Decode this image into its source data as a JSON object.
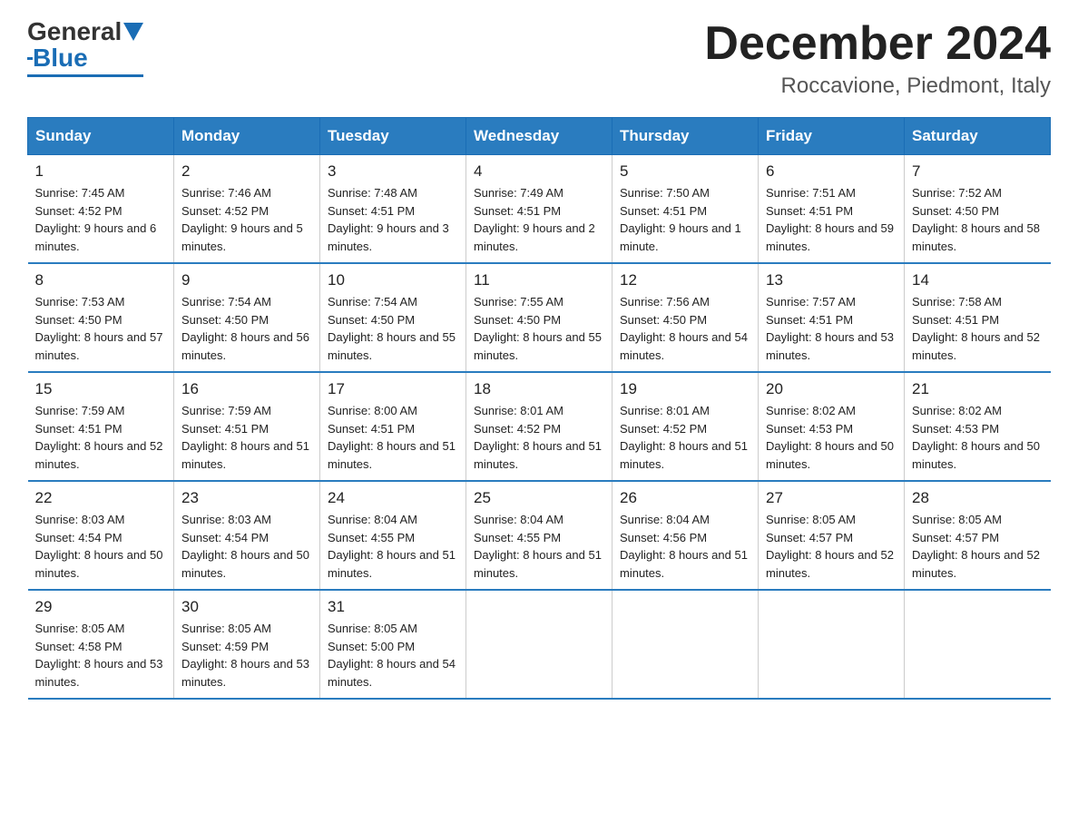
{
  "logo": {
    "text_general": "General",
    "text_blue": "Blue"
  },
  "header": {
    "month": "December 2024",
    "location": "Roccavione, Piedmont, Italy"
  },
  "days_of_week": [
    "Sunday",
    "Monday",
    "Tuesday",
    "Wednesday",
    "Thursday",
    "Friday",
    "Saturday"
  ],
  "weeks": [
    [
      {
        "day": "1",
        "sunrise": "7:45 AM",
        "sunset": "4:52 PM",
        "daylight": "9 hours and 6 minutes."
      },
      {
        "day": "2",
        "sunrise": "7:46 AM",
        "sunset": "4:52 PM",
        "daylight": "9 hours and 5 minutes."
      },
      {
        "day": "3",
        "sunrise": "7:48 AM",
        "sunset": "4:51 PM",
        "daylight": "9 hours and 3 minutes."
      },
      {
        "day": "4",
        "sunrise": "7:49 AM",
        "sunset": "4:51 PM",
        "daylight": "9 hours and 2 minutes."
      },
      {
        "day": "5",
        "sunrise": "7:50 AM",
        "sunset": "4:51 PM",
        "daylight": "9 hours and 1 minute."
      },
      {
        "day": "6",
        "sunrise": "7:51 AM",
        "sunset": "4:51 PM",
        "daylight": "8 hours and 59 minutes."
      },
      {
        "day": "7",
        "sunrise": "7:52 AM",
        "sunset": "4:50 PM",
        "daylight": "8 hours and 58 minutes."
      }
    ],
    [
      {
        "day": "8",
        "sunrise": "7:53 AM",
        "sunset": "4:50 PM",
        "daylight": "8 hours and 57 minutes."
      },
      {
        "day": "9",
        "sunrise": "7:54 AM",
        "sunset": "4:50 PM",
        "daylight": "8 hours and 56 minutes."
      },
      {
        "day": "10",
        "sunrise": "7:54 AM",
        "sunset": "4:50 PM",
        "daylight": "8 hours and 55 minutes."
      },
      {
        "day": "11",
        "sunrise": "7:55 AM",
        "sunset": "4:50 PM",
        "daylight": "8 hours and 55 minutes."
      },
      {
        "day": "12",
        "sunrise": "7:56 AM",
        "sunset": "4:50 PM",
        "daylight": "8 hours and 54 minutes."
      },
      {
        "day": "13",
        "sunrise": "7:57 AM",
        "sunset": "4:51 PM",
        "daylight": "8 hours and 53 minutes."
      },
      {
        "day": "14",
        "sunrise": "7:58 AM",
        "sunset": "4:51 PM",
        "daylight": "8 hours and 52 minutes."
      }
    ],
    [
      {
        "day": "15",
        "sunrise": "7:59 AM",
        "sunset": "4:51 PM",
        "daylight": "8 hours and 52 minutes."
      },
      {
        "day": "16",
        "sunrise": "7:59 AM",
        "sunset": "4:51 PM",
        "daylight": "8 hours and 51 minutes."
      },
      {
        "day": "17",
        "sunrise": "8:00 AM",
        "sunset": "4:51 PM",
        "daylight": "8 hours and 51 minutes."
      },
      {
        "day": "18",
        "sunrise": "8:01 AM",
        "sunset": "4:52 PM",
        "daylight": "8 hours and 51 minutes."
      },
      {
        "day": "19",
        "sunrise": "8:01 AM",
        "sunset": "4:52 PM",
        "daylight": "8 hours and 51 minutes."
      },
      {
        "day": "20",
        "sunrise": "8:02 AM",
        "sunset": "4:53 PM",
        "daylight": "8 hours and 50 minutes."
      },
      {
        "day": "21",
        "sunrise": "8:02 AM",
        "sunset": "4:53 PM",
        "daylight": "8 hours and 50 minutes."
      }
    ],
    [
      {
        "day": "22",
        "sunrise": "8:03 AM",
        "sunset": "4:54 PM",
        "daylight": "8 hours and 50 minutes."
      },
      {
        "day": "23",
        "sunrise": "8:03 AM",
        "sunset": "4:54 PM",
        "daylight": "8 hours and 50 minutes."
      },
      {
        "day": "24",
        "sunrise": "8:04 AM",
        "sunset": "4:55 PM",
        "daylight": "8 hours and 51 minutes."
      },
      {
        "day": "25",
        "sunrise": "8:04 AM",
        "sunset": "4:55 PM",
        "daylight": "8 hours and 51 minutes."
      },
      {
        "day": "26",
        "sunrise": "8:04 AM",
        "sunset": "4:56 PM",
        "daylight": "8 hours and 51 minutes."
      },
      {
        "day": "27",
        "sunrise": "8:05 AM",
        "sunset": "4:57 PM",
        "daylight": "8 hours and 52 minutes."
      },
      {
        "day": "28",
        "sunrise": "8:05 AM",
        "sunset": "4:57 PM",
        "daylight": "8 hours and 52 minutes."
      }
    ],
    [
      {
        "day": "29",
        "sunrise": "8:05 AM",
        "sunset": "4:58 PM",
        "daylight": "8 hours and 53 minutes."
      },
      {
        "day": "30",
        "sunrise": "8:05 AM",
        "sunset": "4:59 PM",
        "daylight": "8 hours and 53 minutes."
      },
      {
        "day": "31",
        "sunrise": "8:05 AM",
        "sunset": "5:00 PM",
        "daylight": "8 hours and 54 minutes."
      },
      null,
      null,
      null,
      null
    ]
  ],
  "labels": {
    "sunrise": "Sunrise:",
    "sunset": "Sunset:",
    "daylight": "Daylight:"
  }
}
